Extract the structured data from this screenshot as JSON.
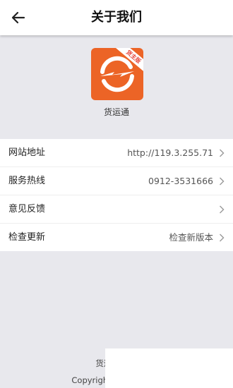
{
  "header": {
    "title": "关于我们",
    "back_icon": "arrow-left-icon"
  },
  "app": {
    "name": "货运通",
    "badge": "货主版",
    "logo_color": "#ec6426",
    "logo_icon": "lightning-circle-icon"
  },
  "rows": [
    {
      "label": "网站地址",
      "value": "http://119.3.255.71"
    },
    {
      "label": "服务热线",
      "value": "0912-3531666"
    },
    {
      "label": "意见反馈",
      "value": ""
    },
    {
      "label": "检查更新",
      "value": "检查新版本"
    }
  ],
  "footer": {
    "line1": "货运通",
    "line2": "Copyright©货运通"
  }
}
